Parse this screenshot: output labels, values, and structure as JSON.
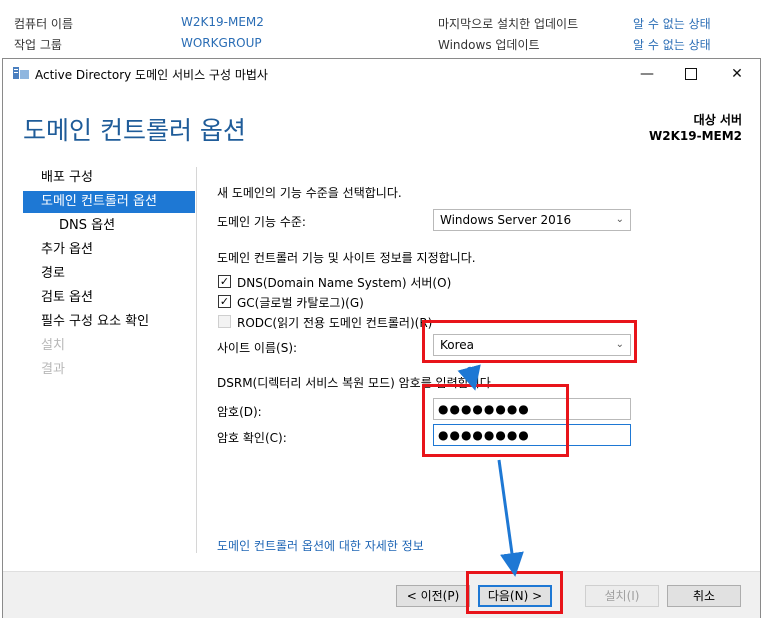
{
  "background": {
    "rows": [
      {
        "label": "컴퓨터 이름",
        "value": "W2K19-MEM2",
        "label2": "마지막으로 설치한 업데이트",
        "value2": "알 수 없는 상태"
      },
      {
        "label": "작업 그룹",
        "value": "WORKGROUP",
        "label2": "Windows 업데이트",
        "value2": "알 수 없는 상태"
      }
    ]
  },
  "window": {
    "title": "Active Directory 도메인 서비스 구성 마법사",
    "minimize": "—",
    "close": "✕"
  },
  "header": {
    "page_title": "도메인 컨트롤러 옵션",
    "target_label": "대상 서버",
    "target_value": "W2K19-MEM2"
  },
  "nav": {
    "items": [
      {
        "label": "배포 구성"
      },
      {
        "label": "도메인 컨트롤러 옵션"
      },
      {
        "label": "DNS 옵션"
      },
      {
        "label": "추가 옵션"
      },
      {
        "label": "경로"
      },
      {
        "label": "검토 옵션"
      },
      {
        "label": "필수 구성 요소 확인"
      },
      {
        "label": "설치"
      },
      {
        "label": "결과"
      }
    ]
  },
  "content": {
    "func_level_prompt": "새 도메인의 기능 수준을 선택합니다.",
    "func_level_label": "도메인 기능 수준:",
    "func_level_value": "Windows Server 2016",
    "capabilities_prompt": "도메인 컨트롤러 기능 및 사이트 정보를 지정합니다.",
    "checkboxes": [
      {
        "label": "DNS(Domain Name System) 서버(O)",
        "checked": true
      },
      {
        "label": "GC(글로벌 카탈로그)(G)",
        "checked": true
      },
      {
        "label": "RODC(읽기 전용 도메인 컨트롤러)(R)",
        "checked": false
      }
    ],
    "check_mark": "✓",
    "site_label": "사이트 이름(S):",
    "site_value": "Korea",
    "dsrm_prompt": "DSRM(디렉터리 서비스 복원 모드) 암호를 입력합니다.",
    "password_label": "암호(D):",
    "password_value": "●●●●●●●●",
    "confirm_label": "암호 확인(C):",
    "confirm_value": "●●●●●●●●",
    "more_info_link": "도메인 컨트롤러 옵션에 대한 자세한 정보",
    "chevron": "⌄"
  },
  "footer": {
    "prev": "< 이전(P)",
    "next": "다음(N) >",
    "install": "설치(I)",
    "cancel": "취소"
  },
  "colors": {
    "accent": "#1e78d4",
    "annotation": "#e8141a",
    "arrow": "#1e78d4"
  }
}
